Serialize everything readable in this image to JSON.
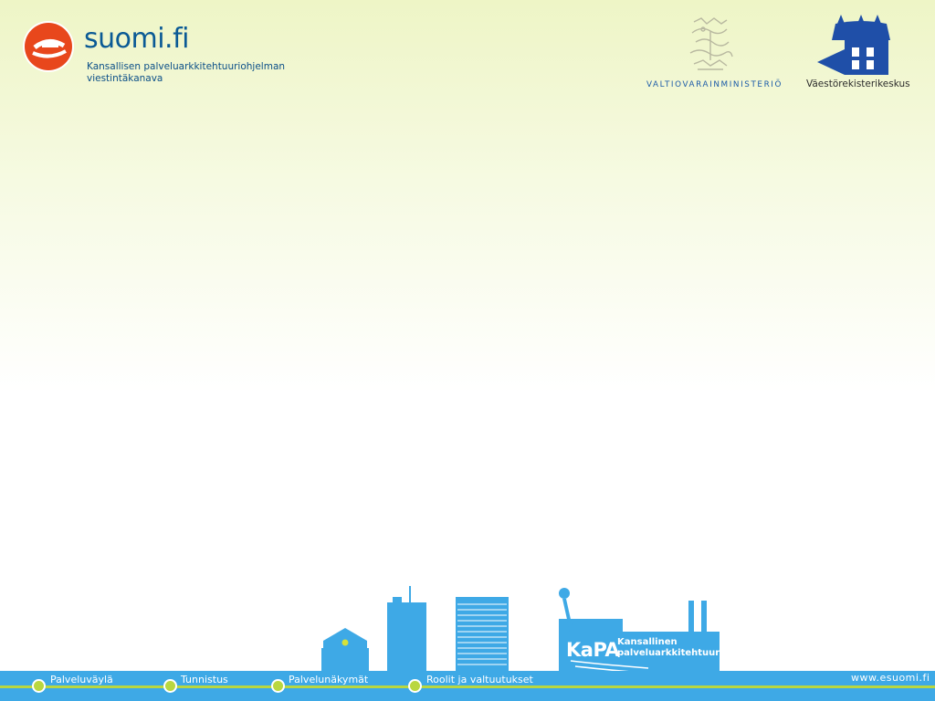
{
  "header": {
    "brand": "suomi.fi",
    "tagline_line1": "Kansallisen palveluarkkitehtuuriohjelman",
    "tagline_line2": "viestintäkanava",
    "ministry": "VALTIOVARAINMINISTERIÖ",
    "agency": "Väestörekisterikeskus"
  },
  "skyline": {
    "kapa_title": "KaPA",
    "kapa_sub_line1": "Kansallinen",
    "kapa_sub_line2": "palveluarkkitehtuuri"
  },
  "footer": {
    "nav_items": [
      {
        "label": "Palveluväylä"
      },
      {
        "label": "Tunnistus"
      },
      {
        "label": "Palvelunäkymät"
      },
      {
        "label": "Roolit ja valtuutukset"
      }
    ],
    "url": "www.esuomi.fi"
  },
  "colors": {
    "footer_bar": "#3ea9e6",
    "footer_line": "#b9d740",
    "brand_orange": "#e8471c",
    "brand_blue": "#0b5a95"
  },
  "icons": {
    "suomi_logo": "e-globe-icon",
    "ministry_crest": "lion-crest-icon",
    "agency_logo": "building-icon"
  }
}
